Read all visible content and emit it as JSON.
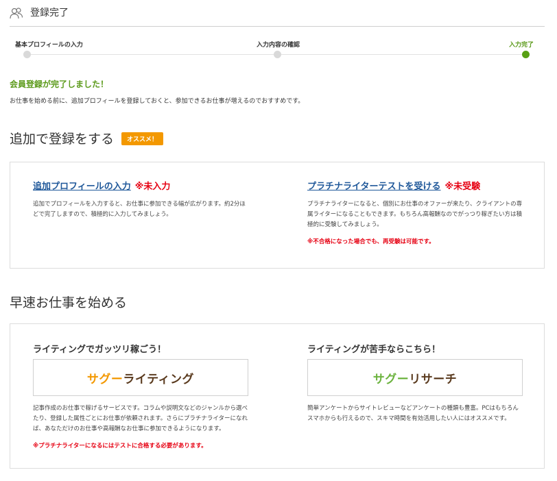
{
  "header": {
    "title": "登録完了",
    "icon": "users-icon"
  },
  "steps": [
    {
      "label": "基本プロフィールの入力",
      "state": "done"
    },
    {
      "label": "入力内容の確認",
      "state": "done"
    },
    {
      "label": "入力完了",
      "state": "current"
    }
  ],
  "complete": {
    "title": "会員登録が完了しました！",
    "desc": "お仕事を始める前に、追加プロフィールを登録しておくと、参加できるお仕事が増えるのでおすすめです。"
  },
  "register_section": {
    "title": "追加で登録をする",
    "badge": "オススメ！",
    "items": [
      {
        "link": "追加プロフィールの入力",
        "status": "※未入力",
        "desc": "追加でプロフィールを入力すると、お仕事に参加できる幅が広がります。約2分ほどで完了しますので、積極的に入力してみましょう。",
        "note": ""
      },
      {
        "link": "プラチナライターテストを受ける",
        "status": "※未受験",
        "desc": "プラチナライターになると、個別にお仕事のオファーが来たり、クライアントの専属ライターになることもできます。もちろん高報酬なのでがっつり稼ぎたい方は積極的に受験してみましょう。",
        "note": "※不合格になった場合でも、再受験は可能です。"
      }
    ]
  },
  "start_section": {
    "title": "早速お仕事を始める",
    "items": [
      {
        "heading": "ライティングでガッツリ稼ごう！",
        "logo_part1": "サグー",
        "logo_part2": "ライティング",
        "desc": "記事作成のお仕事で稼げるサービスです。コラムや説明文などのジャンルから選べたり、登録した属性ごとにお仕事が依頼されます。さらにプラチナライターになれば、あなただけのお仕事や高報酬なお仕事に参加できるようになります。",
        "note": "※プラチナライターになるにはテストに合格する必要があります。"
      },
      {
        "heading": "ライティングが苦手ならこちら！",
        "logo_part1": "サグー",
        "logo_part2": "リサーチ",
        "desc": "簡単アンケートからサイトレビューなどアンケートの種類も豊富。PCはもちろんスマホからも行えるので、スキマ時間を有効活用したい人にはオススメです。",
        "note": ""
      }
    ]
  }
}
